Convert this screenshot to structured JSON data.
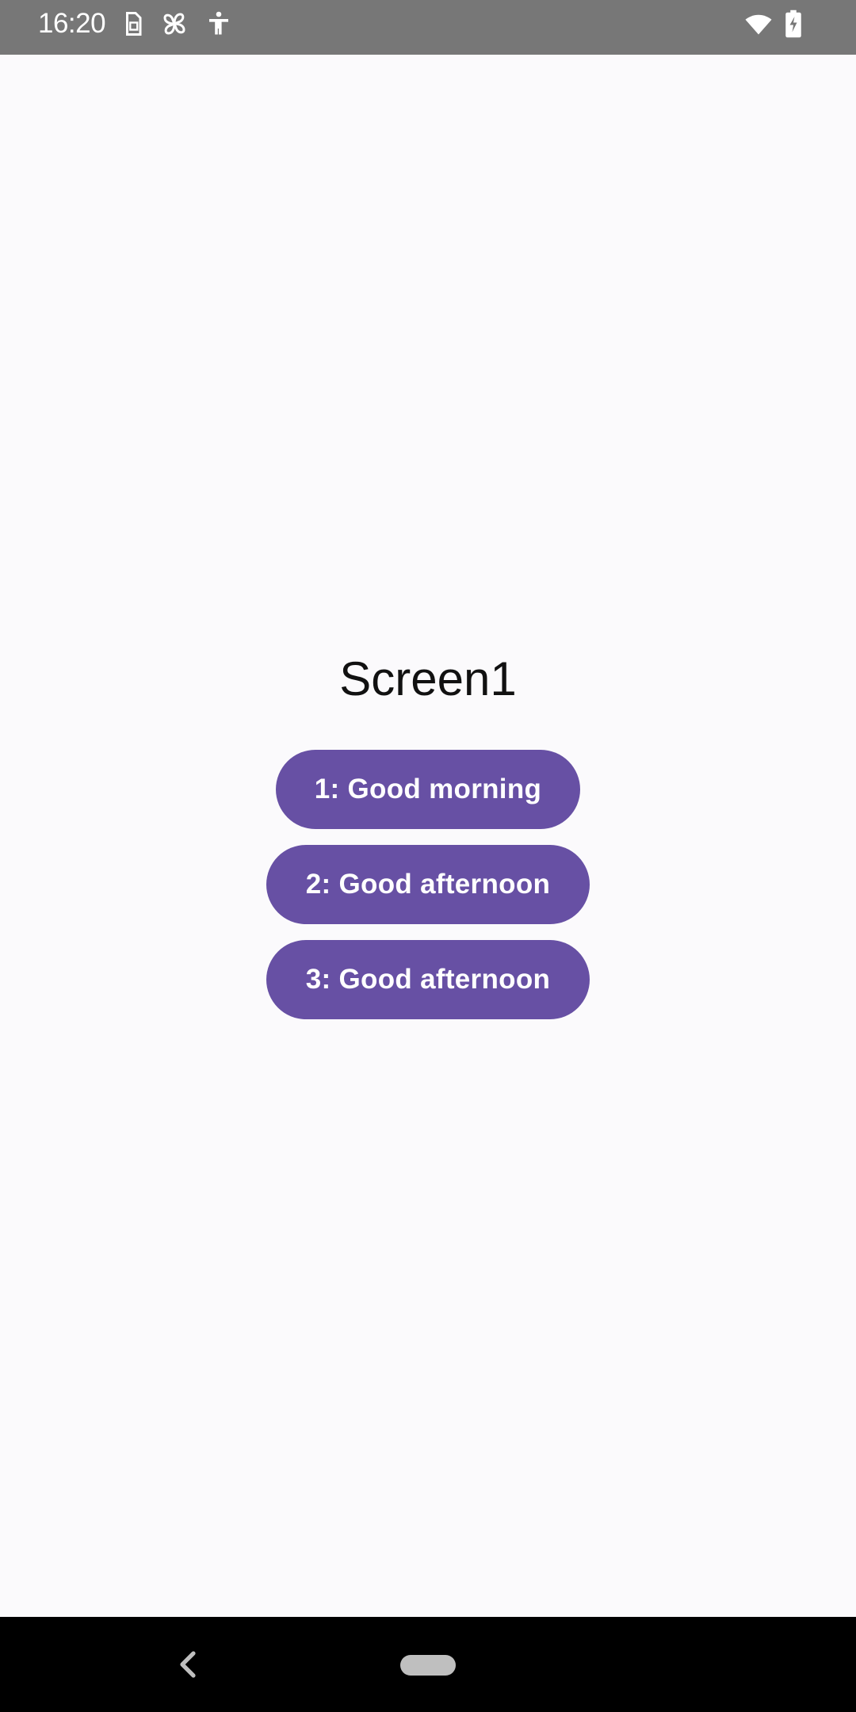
{
  "status_bar": {
    "time": "16:20",
    "icons": [
      "sim-card-icon",
      "fan-icon",
      "accessibility-icon",
      "wifi-icon",
      "battery-charging-icon"
    ]
  },
  "screen": {
    "title": "Screen1",
    "buttons": [
      {
        "label": "1: Good morning"
      },
      {
        "label": "2: Good afternoon"
      },
      {
        "label": "3: Good afternoon"
      }
    ]
  },
  "nav_bar": {
    "icons": [
      "back-icon",
      "home-pill-icon"
    ]
  },
  "colors": {
    "button_bg": "#6750A4",
    "status_bar_bg": "#777777",
    "nav_bar_bg": "#000000",
    "background": "#FBFAFC"
  }
}
